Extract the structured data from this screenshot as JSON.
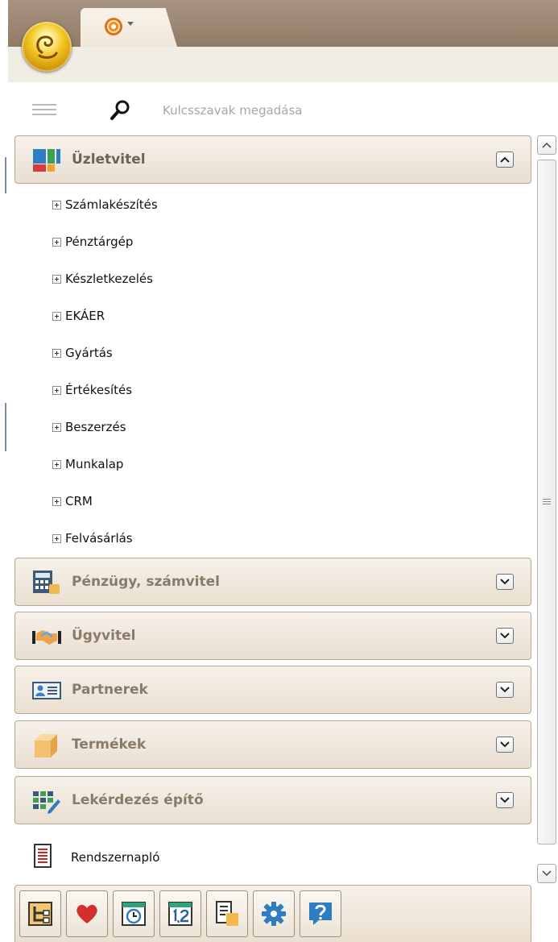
{
  "search": {
    "placeholder": "Kulcsszavak megadása"
  },
  "panels": [
    {
      "label": "Üzletvitel",
      "icon": "business-icon",
      "expanded": true,
      "items": [
        "Számlakészítés",
        "Pénztárgép",
        "Készletkezelés",
        "EKÁER",
        "Gyártás",
        "Értékesítés",
        "Beszerzés",
        "Munkalap",
        "CRM",
        "Felvásárlás"
      ]
    },
    {
      "label": "Pénzügy, számvitel",
      "icon": "calculator-icon",
      "expanded": false
    },
    {
      "label": "Ügyvitel",
      "icon": "handshake-icon",
      "expanded": false
    },
    {
      "label": "Partnerek",
      "icon": "contact-card-icon",
      "expanded": false
    },
    {
      "label": "Termékek",
      "icon": "box-icon",
      "expanded": false
    },
    {
      "label": "Lekérdezés építő",
      "icon": "query-builder-icon",
      "expanded": false
    }
  ],
  "log_item": {
    "label": "Rendszernapló",
    "icon": "log-document-icon"
  },
  "toolbar": [
    "tree-view-icon",
    "favorites-heart-icon",
    "history-clock-icon",
    "numbering-icon",
    "document-list-icon",
    "settings-gear-icon",
    "help-icon"
  ],
  "colors": {
    "header": "#8f7b66",
    "panel": "#e9dfd1",
    "accent_orange": "#e46f12",
    "orb_gold": "#f3c623"
  }
}
